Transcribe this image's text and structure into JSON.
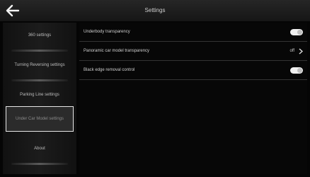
{
  "header": {
    "title": "Settings",
    "back_icon": "arrow-left-icon"
  },
  "sidebar": {
    "items": [
      {
        "label": "360 settings"
      },
      {
        "label": "Turning Reversing settings"
      },
      {
        "label": "Parking Line settings"
      },
      {
        "label": "Under Car Model settings",
        "selected": true
      },
      {
        "label": "About"
      }
    ]
  },
  "settings": {
    "rows": [
      {
        "label": "Underbody transparency",
        "control": "toggle",
        "on": true
      },
      {
        "label": "Panoramic car model transparency",
        "control": "value",
        "value": "off"
      },
      {
        "label": "Black edge removal control",
        "control": "toggle",
        "on": true
      }
    ]
  },
  "colors": {
    "accent": "#f0f0f0",
    "background": "#050505",
    "header": "#1e1e1e"
  }
}
